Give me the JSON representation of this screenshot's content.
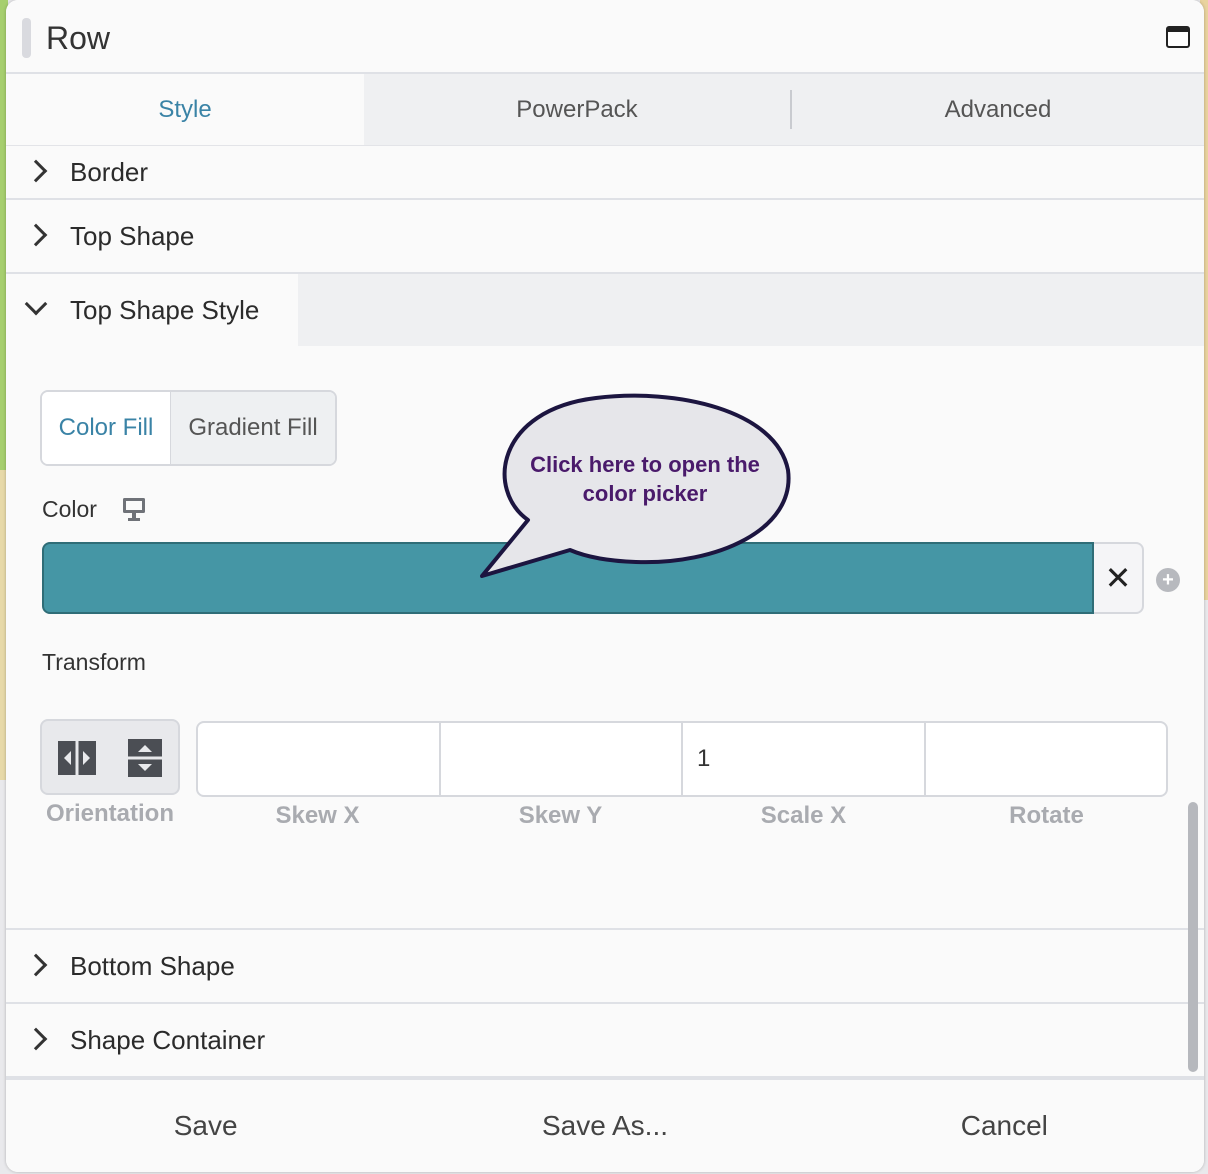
{
  "window": {
    "title": "Row",
    "maximize_icon": "window-maximize-icon"
  },
  "tabs": [
    {
      "label": "Style",
      "active": true
    },
    {
      "label": "PowerPack",
      "active": false
    },
    {
      "label": "Advanced",
      "active": false
    }
  ],
  "sections": {
    "border": "Border",
    "top_shape": "Top Shape",
    "top_shape_style": "Top Shape Style",
    "bottom_shape": "Bottom Shape",
    "shape_container": "Shape Container"
  },
  "fill_toggle": {
    "color_fill": "Color Fill",
    "gradient_fill": "Gradient Fill",
    "selected": "Color Fill"
  },
  "color": {
    "label": "Color",
    "value": "#4596a5",
    "clear_icon": "close-icon",
    "add_icon": "plus-circle-icon",
    "device_icon": "monitor-icon"
  },
  "transform": {
    "label": "Transform",
    "orientation_label": "Orientation",
    "fields": [
      {
        "label": "Skew X",
        "value": ""
      },
      {
        "label": "Skew Y",
        "value": ""
      },
      {
        "label": "Scale X",
        "value": "1"
      },
      {
        "label": "Rotate",
        "value": ""
      }
    ]
  },
  "tooltip": {
    "text": "Click here to open the color picker"
  },
  "footer": {
    "save": "Save",
    "save_as": "Save As...",
    "cancel": "Cancel"
  },
  "colors": {
    "accent": "#3a83a6",
    "swatch": "#4596a5",
    "tooltip_text": "#4a1a6b"
  }
}
